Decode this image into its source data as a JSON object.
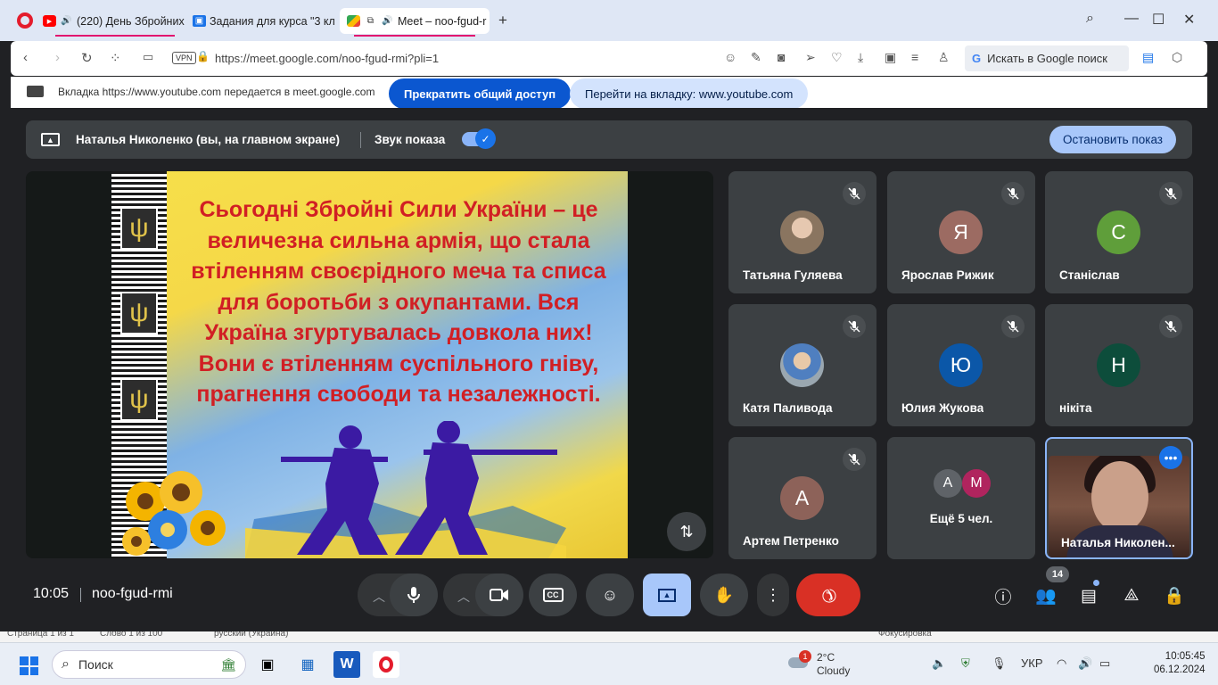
{
  "browser": {
    "tabs": [
      {
        "label": "(220) День Збройних",
        "icon": "youtube-icon"
      },
      {
        "label": "Задания для курса \"3 кла",
        "icon": "classroom-icon"
      },
      {
        "label": "Meet – noo-fgud-r",
        "icon": "meet-icon"
      }
    ],
    "url": "https://meet.google.com/noo-fgud-rmi?pli=1",
    "vpn_label": "VPN",
    "search_label": "Искать в Google поиск",
    "share_message": "Вкладка https://www.youtube.com передается в meet.google.com",
    "stop_sharing_button": "Прекратить общий доступ",
    "goto_tab_button": "Перейти на вкладку: www.youtube.com"
  },
  "presentation_bar": {
    "presenter": "Наталья Николенко (вы, на главном экране)",
    "sound_label": "Звук показа",
    "sound_on": true,
    "stop_button": "Остановить показ"
  },
  "slide": {
    "text": "Сьогодні Збройні Сили України – це величезна сильна армія, що стала втіленням своєрідного меча та списа для боротьби з окупантами. Вся Україна згуртувалась довкола них! Вони є втіленням суспільного гніву, прагнення свободи та незалежності."
  },
  "participants": [
    {
      "name": "Татьяна Гуляева",
      "initial": "",
      "color": "#c9b59b",
      "muted": true
    },
    {
      "name": "Ярослав Рижик",
      "initial": "Я",
      "color": "#9c6b62",
      "muted": true
    },
    {
      "name": "Станіслав",
      "initial": "С",
      "color": "#5f9e3a",
      "muted": true
    },
    {
      "name": "Катя Паливода",
      "initial": "",
      "color": "#9aa7b0",
      "muted": true
    },
    {
      "name": "Юлия Жукова",
      "initial": "Ю",
      "color": "#0b57a8",
      "muted": true
    },
    {
      "name": "нікіта",
      "initial": "Н",
      "color": "#0d4d3b",
      "muted": true
    },
    {
      "name": "Артем Петренко",
      "initial": "А",
      "color": "#8d6259",
      "muted": true
    }
  ],
  "more_tile": {
    "label": "Ещё 5 чел.",
    "avatars": [
      {
        "initial": "А",
        "color": "#5f6368"
      },
      {
        "initial": "М",
        "color": "#b0245e"
      }
    ]
  },
  "self_tile": {
    "name": "Наталья Николен..."
  },
  "controls": {
    "time": "10:05",
    "meeting_code": "noo-fgud-rmi",
    "participant_count": "14"
  },
  "taskbar": {
    "search_label": "Поиск",
    "weather_temp": "2°C",
    "weather_desc": "Cloudy",
    "weather_badge": "1",
    "language": "УКР",
    "time": "10:05:45",
    "date": "06.12.2024"
  },
  "word_status": {
    "items": [
      "Страница 1 из 1",
      "Слово 1 из 100",
      "русский (Украина)",
      "Фокусировка"
    ]
  }
}
